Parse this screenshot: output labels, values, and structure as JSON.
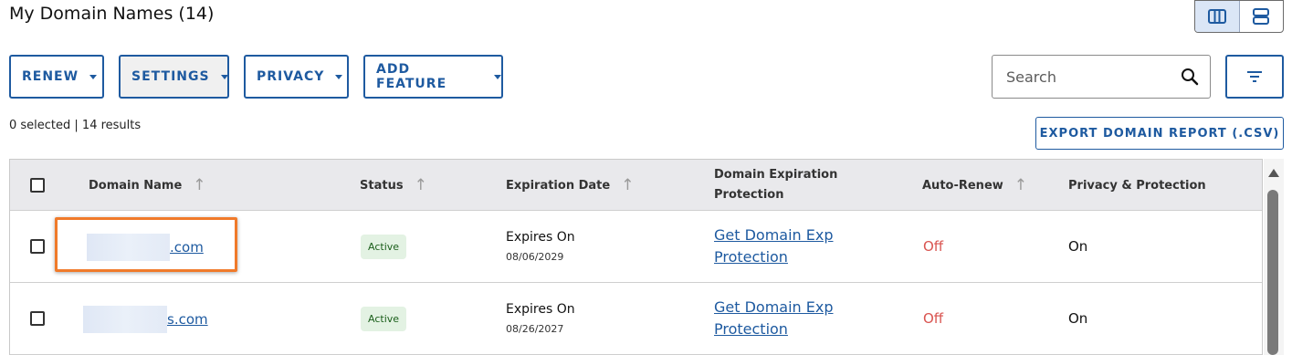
{
  "page": {
    "title": "My Domain Names (14)"
  },
  "view_toggle": {
    "options": [
      "column-view",
      "list-view"
    ],
    "active": "column-view"
  },
  "toolbar": {
    "renew_label": "RENEW",
    "settings_label": "SETTINGS",
    "privacy_label": "PRIVACY",
    "add_feature_label": "ADD FEATURE"
  },
  "search": {
    "placeholder": "Search",
    "value": ""
  },
  "summary": {
    "text": "0 selected | 14 results"
  },
  "export": {
    "label": "EXPORT DOMAIN REPORT (.CSV)"
  },
  "table": {
    "headers": {
      "domain": "Domain Name",
      "status": "Status",
      "expiration": "Expiration Date",
      "protection_line1": "Domain Expiration",
      "protection_line2": "Protection",
      "auto_renew": "Auto-Renew",
      "privacy": "Privacy & Protection"
    },
    "rows": [
      {
        "domain_visible": ".com",
        "status": "Active",
        "expires_label": "Expires On",
        "expires_date": "08/06/2029",
        "protection_line1": "Get Domain Exp",
        "protection_line2": "Protection",
        "auto_renew": "Off",
        "privacy": "On"
      },
      {
        "domain_visible": "s.com",
        "status": "Active",
        "expires_label": "Expires On",
        "expires_date": "08/26/2027",
        "protection_line1": "Get Domain Exp",
        "protection_line2": "Protection",
        "auto_renew": "Off",
        "privacy": "On"
      }
    ]
  },
  "colors": {
    "accent": "#1e5aa0",
    "highlight": "#f07a2a",
    "off": "#d9534f",
    "active_badge_bg": "#e3f2e3",
    "header_bg": "#e9e9ec"
  },
  "icons": [
    "column-view-icon",
    "list-view-icon",
    "search-icon",
    "filter-icon",
    "chevron-down-icon",
    "sort-arrow-icon",
    "scroll-up-icon"
  ]
}
